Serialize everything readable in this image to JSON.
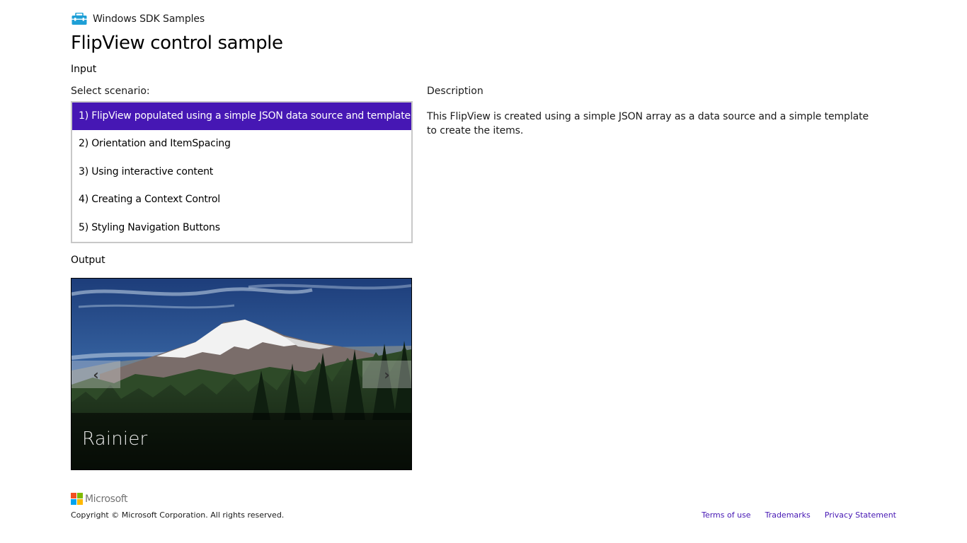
{
  "header": {
    "app_icon": "toolbox-icon",
    "app_title": "Windows SDK Samples",
    "page_title": "FlipView control sample"
  },
  "input": {
    "section_label": "Input",
    "select_label": "Select scenario:",
    "scenarios": [
      {
        "label": "1) FlipView populated using a simple JSON data source and template",
        "selected": true
      },
      {
        "label": "2) Orientation and ItemSpacing",
        "selected": false
      },
      {
        "label": "3) Using interactive content",
        "selected": false
      },
      {
        "label": "4) Creating a Context Control",
        "selected": false
      },
      {
        "label": "5) Styling Navigation Buttons",
        "selected": false
      }
    ],
    "description_label": "Description",
    "description_text": "This FlipView is created using a simple JSON array as a data source and a simple template to create the items."
  },
  "output": {
    "section_label": "Output",
    "flipview": {
      "image_subject": "mountain landscape",
      "caption": "Rainier",
      "prev_icon": "chevron-left-icon",
      "next_icon": "chevron-right-icon",
      "prev_glyph": "‹",
      "next_glyph": "›"
    }
  },
  "footer": {
    "logo_text": "Microsoft",
    "logo_colors": [
      "#f25022",
      "#7fba00",
      "#00a4ef",
      "#ffb900"
    ],
    "copyright": "Copyright © Microsoft Corporation. All rights reserved.",
    "links": [
      "Terms of use",
      "Trademarks",
      "Privacy Statement"
    ]
  },
  "colors": {
    "accent": "#4617b4",
    "selected_text": "#ffffff",
    "link": "#4617b4",
    "icon": "#1e9fd6"
  }
}
